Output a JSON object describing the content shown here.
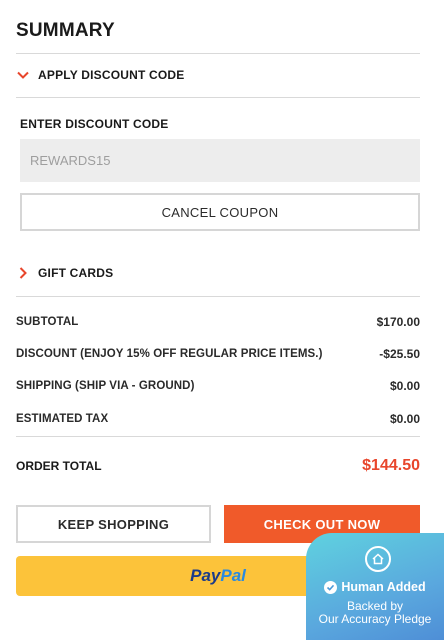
{
  "summary": {
    "title": "SUMMARY"
  },
  "discount_section": {
    "toggle_label": "APPLY DISCOUNT CODE",
    "field_label": "ENTER DISCOUNT CODE",
    "code_value": "REWARDS15",
    "cancel_label": "CANCEL COUPON"
  },
  "gift_cards": {
    "toggle_label": "GIFT CARDS"
  },
  "totals": [
    {
      "label": "SUBTOTAL",
      "value": "$170.00"
    },
    {
      "label": "DISCOUNT (ENJOY 15% OFF REGULAR PRICE ITEMS.)",
      "value": "-$25.50"
    },
    {
      "label": "SHIPPING (SHIP VIA - GROUND)",
      "value": "$0.00"
    },
    {
      "label": "ESTIMATED TAX",
      "value": "$0.00"
    }
  ],
  "order_total": {
    "label": "ORDER TOTAL",
    "value": "$144.50"
  },
  "actions": {
    "keep_shopping": "KEEP SHOPPING",
    "check_out": "CHECK OUT NOW",
    "paypal_part1": "Pay",
    "paypal_part2": "Pal"
  },
  "badge": {
    "line1": "Human Added",
    "line2": "Backed by",
    "line3": "Our Accuracy Pledge"
  },
  "colors": {
    "accent": "#f05a2a",
    "order_total": "#e8462c",
    "paypal_bg": "#fcc33a",
    "paypal_dark": "#1b3b8a",
    "paypal_light": "#2a8ae0"
  },
  "icons": {
    "discount_toggle": "chevron-down-icon",
    "gift_toggle": "chevron-right-icon",
    "badge_top": "home-icon",
    "badge_check": "check-circle-icon"
  }
}
